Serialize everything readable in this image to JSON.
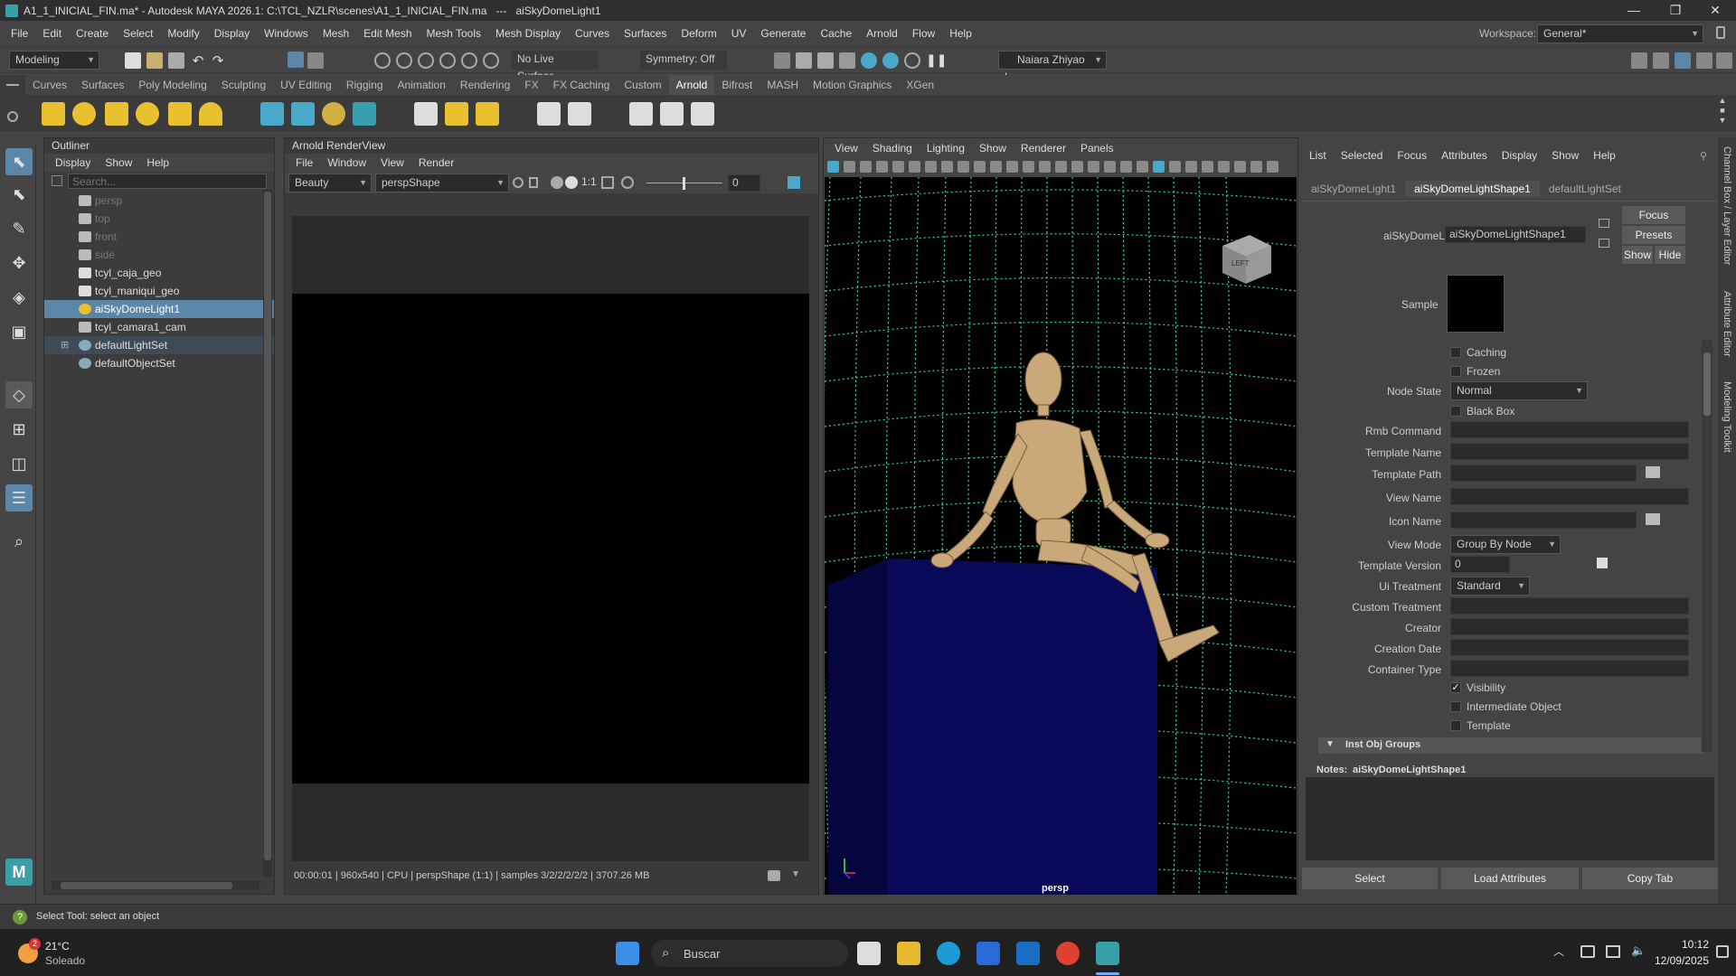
{
  "window": {
    "title": "A1_1_INICIAL_FIN.ma* - Autodesk MAYA 2026.1: C:\\TCL_NZLR\\scenes\\A1_1_INICIAL_FIN.ma   ---   aiSkyDomeLight1",
    "minimize": "—",
    "maximize": "❐",
    "close": "✕"
  },
  "menubar": {
    "items": [
      "File",
      "Edit",
      "Create",
      "Select",
      "Modify",
      "Display",
      "Windows",
      "Mesh",
      "Edit Mesh",
      "Mesh Tools",
      "Mesh Display",
      "Curves",
      "Surfaces",
      "Deform",
      "UV",
      "Generate",
      "Cache",
      "Arnold",
      "Flow",
      "Help"
    ],
    "workspace_label": "Workspace:",
    "workspace_value": "General*"
  },
  "statusline": {
    "menuset": "Modeling",
    "live_surface": "No Live Surface",
    "symmetry": "Symmetry: Off",
    "user": "Naiara Zhiyao L..."
  },
  "shelf": {
    "tabs": [
      "Curves",
      "Surfaces",
      "Poly Modeling",
      "Sculpting",
      "UV Editing",
      "Rigging",
      "Animation",
      "Rendering",
      "FX",
      "FX Caching",
      "Custom",
      "Arnold",
      "Bifrost",
      "MASH",
      "Motion Graphics",
      "XGen"
    ],
    "active": "Arnold"
  },
  "outliner": {
    "title": "Outliner",
    "menu": [
      "Display",
      "Show",
      "Help"
    ],
    "search_placeholder": "Search...",
    "items": [
      {
        "label": "persp",
        "icon": "camera-icon"
      },
      {
        "label": "top",
        "icon": "camera-icon"
      },
      {
        "label": "front",
        "icon": "camera-icon"
      },
      {
        "label": "side",
        "icon": "camera-icon"
      },
      {
        "label": "tcyl_caja_geo",
        "icon": "mesh-icon"
      },
      {
        "label": "tcyl_maniqui_geo",
        "icon": "mesh-icon"
      },
      {
        "label": "aiSkyDomeLight1",
        "icon": "skydome-icon"
      },
      {
        "label": "tcyl_camara1_cam",
        "icon": "camera-icon"
      },
      {
        "label": "defaultLightSet",
        "icon": "set-icon"
      },
      {
        "label": "defaultObjectSet",
        "icon": "set-icon"
      }
    ]
  },
  "renderview": {
    "title": "Arnold RenderView",
    "menu": [
      "File",
      "Window",
      "View",
      "Render"
    ],
    "aov": "Beauty",
    "camera": "perspShape",
    "ratio": "1:1",
    "exposure": "0",
    "status": "00:00:01 | 960x540 | CPU | perspShape (1:1) | samples 3/2/2/2/2/2 | 3707.26 MB"
  },
  "viewport": {
    "menu": [
      "View",
      "Shading",
      "Lighting",
      "Show",
      "Renderer",
      "Panels"
    ],
    "camera_label": "persp",
    "cube_label": "LEFT"
  },
  "attr": {
    "menu": [
      "List",
      "Selected",
      "Focus",
      "Attributes",
      "Display",
      "Show",
      "Help"
    ],
    "tabs": [
      "aiSkyDomeLight1",
      "aiSkyDomeLightShape1",
      "defaultLightSet"
    ],
    "node_label": "aiSkyDomeLight:",
    "node_value": "aiSkyDomeLightShape1",
    "focus": "Focus",
    "presets": "Presets",
    "show": "Show",
    "hide": "Hide",
    "sample_label": "Sample",
    "caching": "Caching",
    "frozen": "Frozen",
    "node_state_label": "Node State",
    "node_state": "Normal",
    "black_box": "Black Box",
    "rmb_command": "Rmb Command",
    "template_name": "Template Name",
    "template_path": "Template Path",
    "view_name": "View Name",
    "icon_name": "Icon Name",
    "view_mode_label": "View Mode",
    "view_mode": "Group By Node",
    "template_version_label": "Template Version",
    "template_version": "0",
    "ui_treatment_label": "Ui Treatment",
    "ui_treatment": "Standard",
    "custom_treatment": "Custom Treatment",
    "creator": "Creator",
    "creation_date": "Creation Date",
    "container_type": "Container Type",
    "visibility": "Visibility",
    "intermediate": "Intermediate Object",
    "template": "Template",
    "section": "Inst Obj Groups",
    "notes_label": "Notes:",
    "notes_value": "aiSkyDomeLightShape1",
    "btn_select": "Select",
    "btn_load": "Load Attributes",
    "btn_copy": "Copy Tab"
  },
  "side_tabs": [
    "Channel Box / Layer Editor",
    "Attribute Editor",
    "Modeling Toolkit"
  ],
  "help_line": "Select Tool: select an object",
  "taskbar": {
    "weather_temp": "21°C",
    "weather_text": "Soleado",
    "weather_badge": "2",
    "search_placeholder": "Buscar",
    "time": "10:12",
    "date": "12/09/2025"
  }
}
